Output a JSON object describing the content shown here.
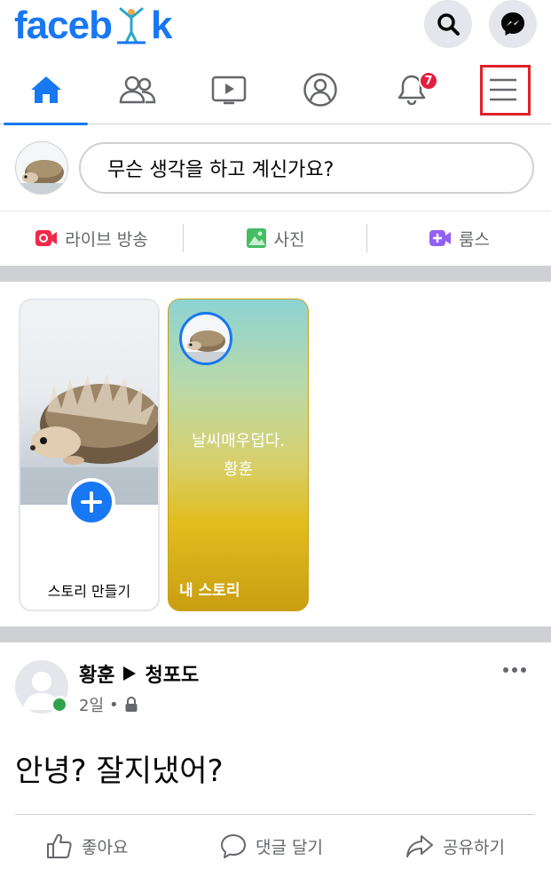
{
  "header": {
    "logo": "faceb",
    "logo_suffix": "k",
    "icons": [
      "search-icon",
      "messenger-icon"
    ]
  },
  "nav": {
    "tabs": [
      {
        "name": "home",
        "icon": "home-icon",
        "active": true
      },
      {
        "name": "friends",
        "icon": "friends-icon"
      },
      {
        "name": "watch",
        "icon": "watch-icon"
      },
      {
        "name": "profile",
        "icon": "profile-icon"
      },
      {
        "name": "notifications",
        "icon": "bell-icon",
        "badge": "7"
      },
      {
        "name": "menu",
        "icon": "menu-icon"
      }
    ]
  },
  "composer": {
    "placeholder": "무슨 생각을 하고 계신가요?"
  },
  "actions": {
    "live": "라이브 방송",
    "photo": "사진",
    "rooms": "룸스"
  },
  "stories": {
    "create_label": "스토리 만들기",
    "my_story_text_line1": "날씨매우덥다.",
    "my_story_text_line2": "황훈",
    "my_story_label": "내 스토리"
  },
  "post": {
    "author": "황훈",
    "target": "청포도",
    "time": "2일",
    "text": "안녕? 잘지냈어?",
    "like": "좋아요",
    "comment": "댓글 달기",
    "share": "공유하기"
  },
  "colors": {
    "brand": "#1877f2",
    "badge": "#e41e3f",
    "highlight": "#e0202a",
    "online": "#31a24c"
  }
}
